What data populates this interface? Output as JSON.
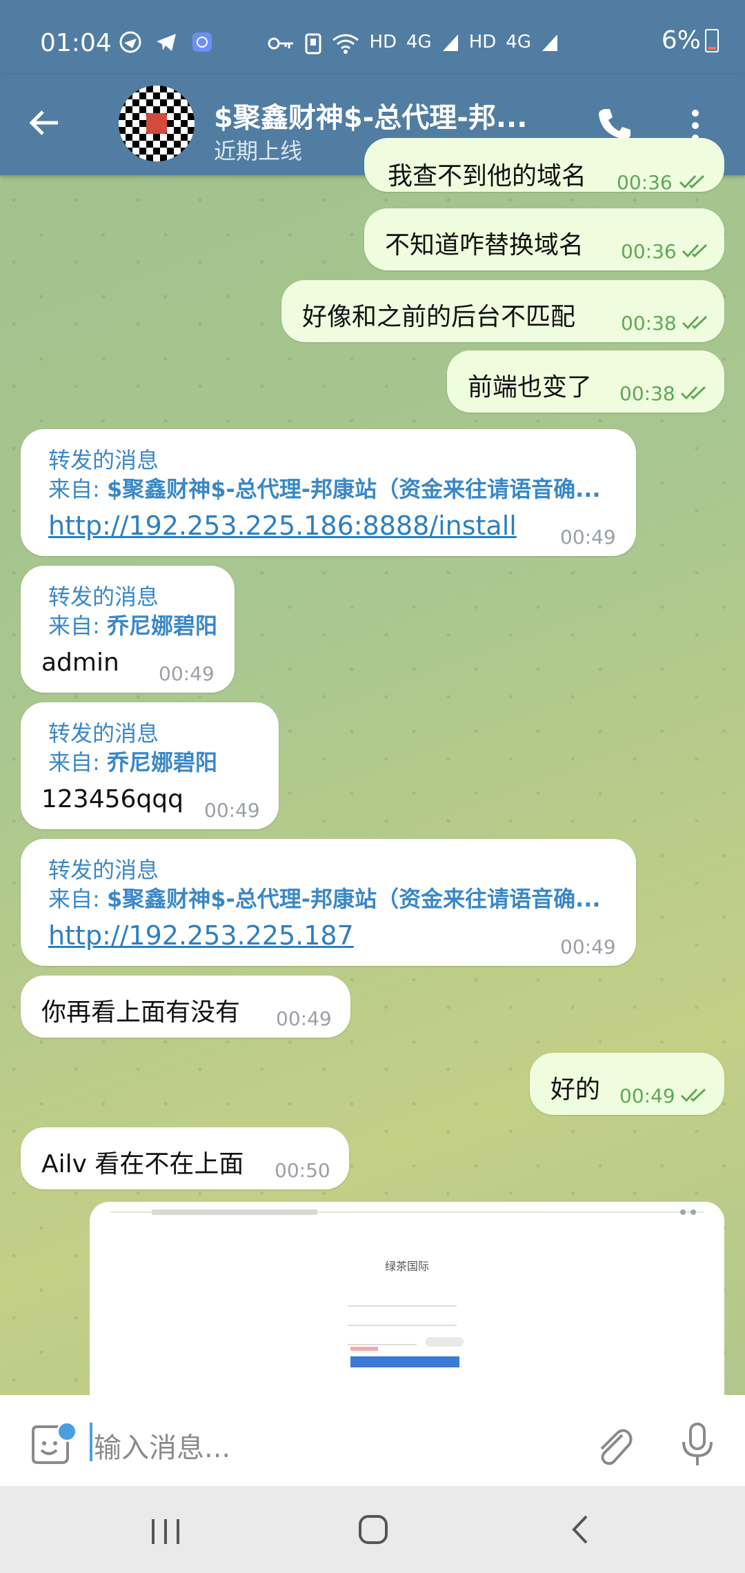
{
  "status": {
    "time": "01:04",
    "network1": "HD",
    "network2": "4G",
    "network3": "HD",
    "network4": "4G",
    "battery": "6%"
  },
  "header": {
    "title": "$聚鑫财神$-总代理-邦...",
    "subtitle": "近期上线"
  },
  "messages": {
    "m0": {
      "text": "我查不到他的域名",
      "time": "00:36"
    },
    "m1": {
      "text": "不知道咋替换域名",
      "time": "00:36"
    },
    "m2": {
      "text": "好像和之前的后台不匹配",
      "time": "00:38"
    },
    "m3": {
      "text": "前端也变了",
      "time": "00:38"
    },
    "m4": {
      "label": "转发的消息",
      "from_prefix": "来自: ",
      "from": "$聚鑫财神$-总代理-邦康站（资金来往请语音确...",
      "link": "http://192.253.225.186:8888/install",
      "time": "00:49"
    },
    "m5": {
      "label": "转发的消息",
      "from_prefix": "来自: ",
      "from": "乔尼娜碧阳",
      "text": "admin",
      "time": "00:49"
    },
    "m6": {
      "label": "转发的消息",
      "from_prefix": "来自: ",
      "from": "乔尼娜碧阳",
      "text": "123456qqq",
      "time": "00:49"
    },
    "m7": {
      "label": "转发的消息",
      "from_prefix": "来自: ",
      "from": "$聚鑫财神$-总代理-邦康站（资金来往请语音确...",
      "link": "http://192.253.225.187",
      "time": "00:49"
    },
    "m8": {
      "text": "你再看上面有没有",
      "time": "00:49"
    },
    "m9": {
      "text": "好的",
      "time": "00:49"
    },
    "m10": {
      "text": "Ailv 看在不在上面",
      "time": "00:50"
    },
    "m11": {
      "image_title": "绿茶国际"
    }
  },
  "input": {
    "placeholder": "输入消息..."
  },
  "colors": {
    "header": "#517da2",
    "outgoing_bubble": "#effdde",
    "incoming_bubble": "#ffffff",
    "link": "#2d7fc1",
    "accent": "#3a87c8"
  }
}
